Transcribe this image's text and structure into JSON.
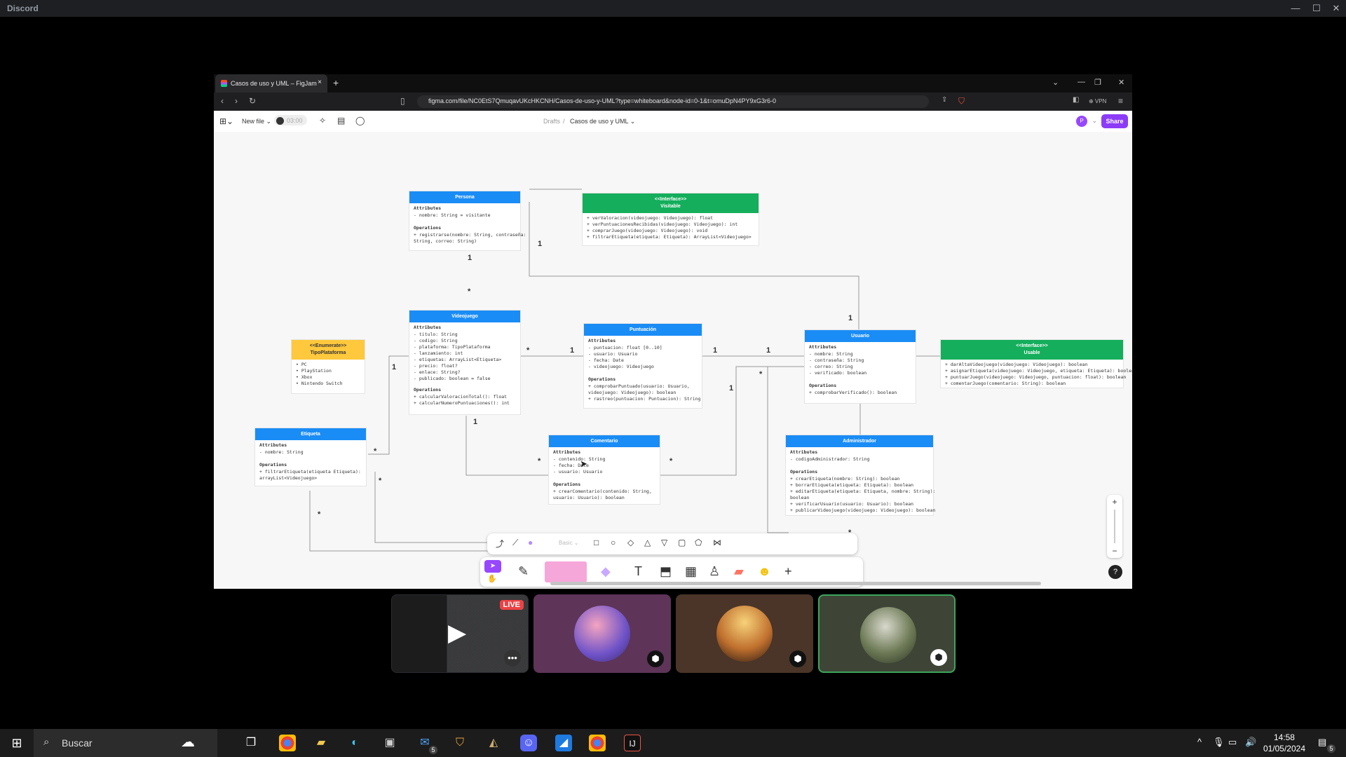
{
  "discord": {
    "title": "Discord",
    "minimize": "—",
    "maximize": "☐",
    "close": "✕"
  },
  "browser": {
    "tab_title": "Casos de uso y UML – FigJam",
    "tab_close": "×",
    "new_tab": "+",
    "url": "figma.com/file/NC0EtS7QmuqavUKcHKCNH/Casos-de-uso-y-UML?type=whiteboard&node-id=0-1&t=omuDpN4PY9xG3r6-0",
    "vpn": "⊕ VPN"
  },
  "figjam": {
    "new_file": "New file ⌄",
    "timer": "03:00",
    "breadcrumb_parent": "Drafts",
    "breadcrumb_sep": "/",
    "file_name": "Casos de uso y UML ⌄",
    "avatar_letter": "P",
    "share": "Share",
    "text_style": "Basic ⌄",
    "zoom_in": "+",
    "zoom_out": "−",
    "help": "?"
  },
  "diagram": {
    "persona": {
      "title": "Persona",
      "attrs_label": "Attributes",
      "attrs": [
        "- nombre: String = visitante"
      ],
      "ops_label": "Operations",
      "ops": [
        "+ registrarse(nombre: String, contraseña:",
        "String, correo: String)"
      ]
    },
    "visitable": {
      "title": "<<Interface>>",
      "subtitle": "Visitable",
      "ops": [
        "+ verValoracion(videojuego: Videojuego): float",
        "+ verPuntuacionesRecibidas(videojuego: Videojuego): int",
        "+ comprarJuego(videojuego: Videojuego): void",
        "+ filtrarEtiqueta(etiqueta: Etiqueta): ArrayList<Videojuego>"
      ]
    },
    "videojuego": {
      "title": "Videojuego",
      "attrs_label": "Attributes",
      "attrs": [
        "- titulo: String",
        "- codigo: String",
        "- plataforma: TipoPlataforma",
        "- lanzamiento: int",
        "- etiquetas: ArrayList<Etiqueta>",
        "- precio: float?",
        "- enlace: String?",
        "- publicado: boolean = false"
      ],
      "ops_label": "Operations",
      "ops": [
        "+ calcularValoracionTotal(): float",
        "+ calcularNumeroPuntuaciones(): int"
      ]
    },
    "puntuacion": {
      "title": "Puntuación",
      "attrs_label": "Attributes",
      "attrs": [
        "- puntuacion: float [0..10]",
        "- usuario: Usuario",
        "- fecha: Date",
        "- videojuego: Videojuego"
      ],
      "ops_label": "Operations",
      "ops": [
        "+ comprobarPuntuado(usuario: Usuario,",
        "videojuego: Videojuego): boolean",
        "+ rastreo(puntuacion: Puntuacion): String"
      ]
    },
    "usuario": {
      "title": "Usuario",
      "attrs_label": "Attributes",
      "attrs": [
        "- nombre: String",
        "- contraseña: String",
        "- correo: String",
        "- verificado: boolean"
      ],
      "ops_label": "Operations",
      "ops": [
        "+ comprobarVerificado(): boolean"
      ]
    },
    "usable": {
      "title": "<<Interface>>",
      "subtitle": "Usable",
      "ops": [
        "+ darAltaVideojuego(videojuego: Videojuego): boolean",
        "+ asignarEtiqueta(videojuego: Videojuego, etiqueta: Etiqueta): boolean",
        "+ puntuarJuego(videojuego: Videojuego, puntuacion: float): boolean",
        "+ comentarJuego(comentario: String): boolean"
      ]
    },
    "tipoplataforma": {
      "title": "<<Enumerate>>",
      "subtitle": "TipoPlataforma",
      "items": [
        "PC",
        "PlayStation",
        "Xbox",
        "Nintendo Switch"
      ]
    },
    "etiqueta": {
      "title": "Etiqueta",
      "attrs_label": "Attributes",
      "attrs": [
        "- nombre: String"
      ],
      "ops_label": "Operations",
      "ops": [
        "+ filtrarEtiqueta(etiqueta Etiqueta):",
        "arrayList<Videojuego>"
      ]
    },
    "comentario": {
      "title": "Comentario",
      "attrs_label": "Attributes",
      "attrs": [
        "- contenido: String",
        "- fecha: Date",
        "- usuario: Usuario"
      ],
      "ops_label": "Operations",
      "ops": [
        "+ crearComentario(contenido: String,",
        "usuario: Usuario): boolean"
      ]
    },
    "administrador": {
      "title": "Administrador",
      "attrs_label": "Attributes",
      "attrs": [
        "- codigoAdministrador: String"
      ],
      "ops_label": "Operations",
      "ops": [
        "+ crearEtiqueta(nombre: String): boolean",
        "+ borrarEtiqueta(etiqueta: Etiqueta): boolean",
        "+ editarEtiqueta(etiqueta: Etiqueta, nombre: String):",
        "boolean",
        "+ verificarUsuario(usuario: Usuario): boolean",
        "+ publicarVideojuego(videojuego: Videojuego): boolean"
      ]
    },
    "multiplicities": {
      "one": "1",
      "many": "*"
    }
  },
  "participants": {
    "live": "LIVE",
    "more": "•••"
  },
  "taskbar": {
    "search_placeholder": "Buscar",
    "time": "14:58",
    "date": "01/05/2024",
    "mail_badge": "5",
    "notif_badge": "5"
  }
}
